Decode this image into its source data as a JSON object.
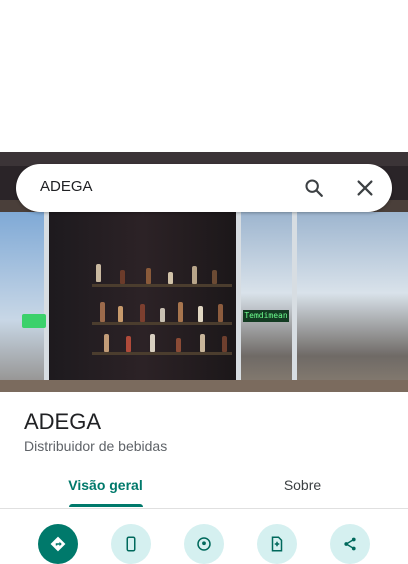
{
  "search": {
    "query": "ADEGA"
  },
  "photo": {
    "sign_text": "Temdimean"
  },
  "place": {
    "title": "ADEGA",
    "category": "Distribuidor de bebidas"
  },
  "tabs": [
    {
      "label": "Visão geral",
      "active": true
    },
    {
      "label": "Sobre",
      "active": false
    }
  ],
  "actions": [
    {
      "icon": "directions-icon",
      "color": "#00796b"
    },
    {
      "icon": "phone-icon",
      "color": "#d5f0f0"
    },
    {
      "icon": "location-icon",
      "color": "#d5f0f0"
    },
    {
      "icon": "add-document-icon",
      "color": "#d5f0f0"
    },
    {
      "icon": "share-icon",
      "color": "#d5f0f0"
    }
  ],
  "colors": {
    "accent": "#00796b",
    "action_bg": "#d5f0f0"
  }
}
